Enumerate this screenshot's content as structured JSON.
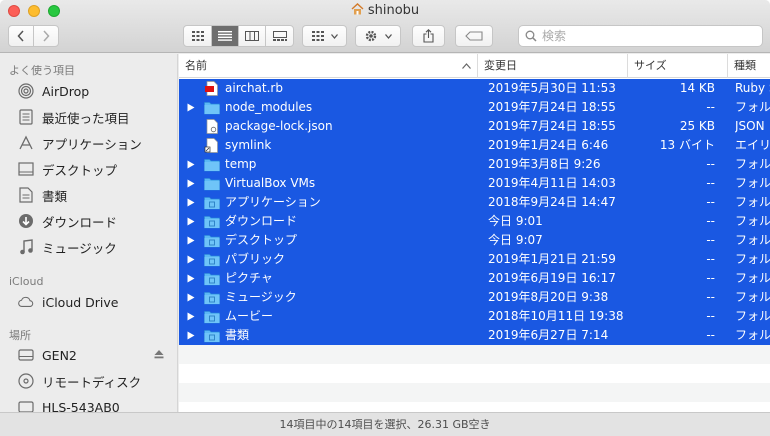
{
  "window": {
    "title": "shinobu"
  },
  "toolbar": {
    "search_placeholder": "検索"
  },
  "sidebar": {
    "favorites_header": "よく使う項目",
    "favorites": [
      {
        "label": "AirDrop",
        "icon": "airdrop-icon"
      },
      {
        "label": "最近使った項目",
        "icon": "recents-icon"
      },
      {
        "label": "アプリケーション",
        "icon": "applications-icon"
      },
      {
        "label": "デスクトップ",
        "icon": "desktop-icon"
      },
      {
        "label": "書類",
        "icon": "documents-icon"
      },
      {
        "label": "ダウンロード",
        "icon": "downloads-icon"
      },
      {
        "label": "ミュージック",
        "icon": "music-icon"
      }
    ],
    "icloud_header": "iCloud",
    "icloud": [
      {
        "label": "iCloud Drive",
        "icon": "cloud-icon"
      }
    ],
    "locations_header": "場所",
    "locations": [
      {
        "label": "GEN2",
        "icon": "drive-icon"
      },
      {
        "label": "リモートディスク",
        "icon": "remote-disc-icon"
      },
      {
        "label": "HLS-543AB0",
        "icon": "network-drive-icon"
      }
    ]
  },
  "columns": {
    "name": "名前",
    "date": "変更日",
    "size": "サイズ",
    "kind": "種類"
  },
  "files": [
    {
      "name": "airchat.rb",
      "date": "2019年5月30日 11:53",
      "size": "14 KB",
      "kind": "Ruby S",
      "folder": false,
      "icon": "ruby-file-icon"
    },
    {
      "name": "node_modules",
      "date": "2019年7月24日 18:55",
      "size": "--",
      "kind": "フォル",
      "folder": true,
      "icon": "folder-icon"
    },
    {
      "name": "package-lock.json",
      "date": "2019年7月24日 18:55",
      "size": "25 KB",
      "kind": "JSON",
      "folder": false,
      "icon": "json-file-icon"
    },
    {
      "name": "symlink",
      "date": "2019年1月24日 6:46",
      "size": "13 バイト",
      "kind": "エイリ",
      "folder": false,
      "icon": "symlink-file-icon"
    },
    {
      "name": "temp",
      "date": "2019年3月8日 9:26",
      "size": "--",
      "kind": "フォル",
      "folder": true,
      "icon": "folder-icon"
    },
    {
      "name": "VirtualBox VMs",
      "date": "2019年4月11日 14:03",
      "size": "--",
      "kind": "フォル",
      "folder": true,
      "icon": "folder-icon"
    },
    {
      "name": "アプリケーション",
      "date": "2018年9月24日 14:47",
      "size": "--",
      "kind": "フォル",
      "folder": true,
      "icon": "applications-folder-icon"
    },
    {
      "name": "ダウンロード",
      "date": "今日 9:01",
      "size": "--",
      "kind": "フォル",
      "folder": true,
      "icon": "downloads-folder-icon"
    },
    {
      "name": "デスクトップ",
      "date": "今日 9:07",
      "size": "--",
      "kind": "フォル",
      "folder": true,
      "icon": "desktop-folder-icon"
    },
    {
      "name": "パブリック",
      "date": "2019年1月21日 21:59",
      "size": "--",
      "kind": "フォル",
      "folder": true,
      "icon": "public-folder-icon"
    },
    {
      "name": "ピクチャ",
      "date": "2019年6月19日 16:17",
      "size": "--",
      "kind": "フォル",
      "folder": true,
      "icon": "pictures-folder-icon"
    },
    {
      "name": "ミュージック",
      "date": "2019年8月20日 9:38",
      "size": "--",
      "kind": "フォル",
      "folder": true,
      "icon": "music-folder-icon"
    },
    {
      "name": "ムービー",
      "date": "2018年10月11日 19:38",
      "size": "--",
      "kind": "フォル",
      "folder": true,
      "icon": "movies-folder-icon"
    },
    {
      "name": "書類",
      "date": "2019年6月27日 7:14",
      "size": "--",
      "kind": "フォル",
      "folder": true,
      "icon": "documents-folder-icon"
    }
  ],
  "status": "14項目中の14項目を選択、26.31 GB空き",
  "colors": {
    "selection": "#1a58e2",
    "sidebar": "#ececec"
  }
}
